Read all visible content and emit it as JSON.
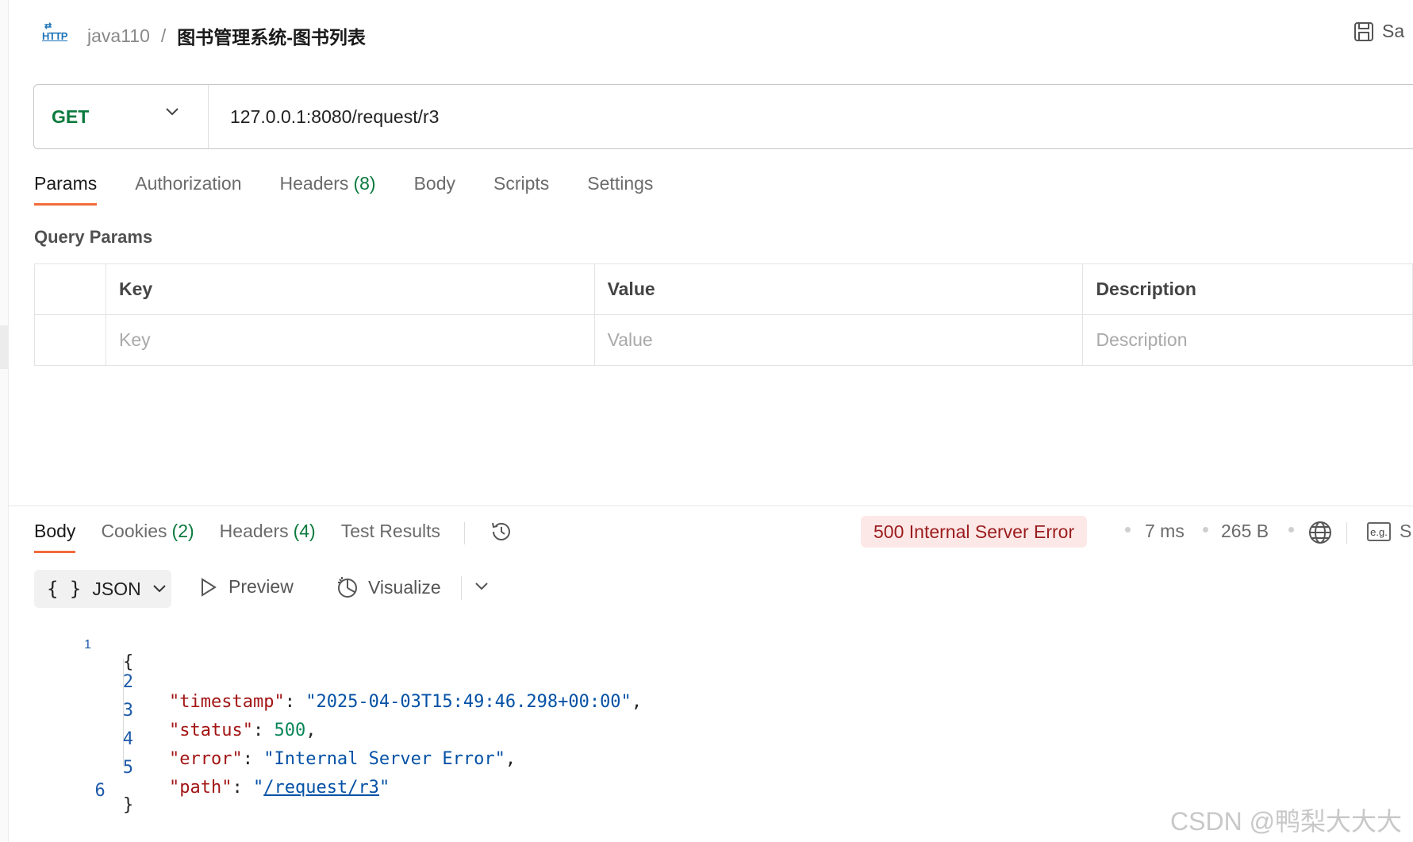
{
  "header": {
    "icon": "http-icon",
    "icon_text": "HTTP",
    "collection": "java110",
    "separator": "/",
    "request_name": "图书管理系统-图书列表",
    "save_label": "Sa"
  },
  "request": {
    "method": "GET",
    "url": "127.0.0.1:8080/request/r3"
  },
  "request_tabs": [
    {
      "label": "Params",
      "count": "",
      "active": true
    },
    {
      "label": "Authorization",
      "count": ""
    },
    {
      "label": "Headers",
      "count": "(8)"
    },
    {
      "label": "Body",
      "count": ""
    },
    {
      "label": "Scripts",
      "count": ""
    },
    {
      "label": "Settings",
      "count": ""
    }
  ],
  "query_params": {
    "title": "Query Params",
    "columns": [
      "Key",
      "Value",
      "Description"
    ],
    "placeholders": [
      "Key",
      "Value",
      "Description"
    ]
  },
  "response_tabs": [
    {
      "label": "Body",
      "count": "",
      "active": true
    },
    {
      "label": "Cookies",
      "count": "(2)"
    },
    {
      "label": "Headers",
      "count": "(4)"
    },
    {
      "label": "Test Results",
      "count": ""
    }
  ],
  "response_meta": {
    "status": "500 Internal Server Error",
    "time": "7 ms",
    "size": "265 B",
    "example_label": "e.g.",
    "trailing": "S"
  },
  "response_toolbar": {
    "format": "JSON",
    "braces": "{ }",
    "preview": "Preview",
    "visualize": "Visualize"
  },
  "response_body": {
    "line_numbers": [
      "1",
      "2",
      "3",
      "4",
      "5",
      "6"
    ],
    "open_brace": "{",
    "close_brace": "}",
    "fields": [
      {
        "key": "\"timestamp\"",
        "value": "\"2025-04-03T15:49:46.298+00:00\"",
        "type": "string",
        "trail": ","
      },
      {
        "key": "\"status\"",
        "value": "500",
        "type": "number",
        "trail": ","
      },
      {
        "key": "\"error\"",
        "value": "\"Internal Server Error\"",
        "type": "string",
        "trail": ","
      },
      {
        "key": "\"path\"",
        "value": "/request/r3",
        "type": "link",
        "trail": ""
      }
    ]
  },
  "colors": {
    "accent_tab": "#f26b3a",
    "method_get": "#0b7a3e",
    "error_badge_bg": "#fde8e8",
    "error_badge_text": "#9b1c1c"
  },
  "watermark": "CSDN @鸭梨大大大"
}
